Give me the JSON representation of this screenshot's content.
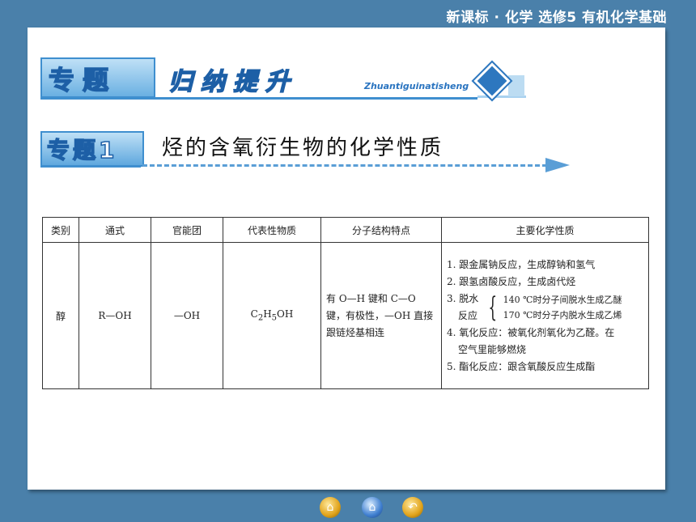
{
  "header": {
    "course": "新课标 · 化学  选修5  有机化学基础"
  },
  "banner": {
    "zhuanti": "专题",
    "guina": "归纳提升",
    "pinyin": "Zhuantiguinatisheng"
  },
  "topic": {
    "badge": "专题1",
    "title": "烃的含氧衍生物的化学性质"
  },
  "table": {
    "headers": [
      "类别",
      "通式",
      "官能团",
      "代表性物质",
      "分子结构特点",
      "主要化学性质"
    ],
    "row": {
      "category": "醇",
      "formula": "R—OH",
      "group": "—OH",
      "rep_main": "C",
      "rep_sub1": "2",
      "rep_mid": "H",
      "rep_sub2": "5",
      "rep_end": "OH",
      "structure": "有 O—H 键和 C—O 键，有极性，—OH 直接跟链烃基相连",
      "props": [
        "1. 跟金属钠反应，生成醇钠和氢气",
        "2. 跟氢卤酸反应，生成卤代烃",
        "3. 脱水",
        "反应",
        "140 ℃时分子间脱水生成乙醚",
        "170 ℃时分子内脱水生成乙烯",
        "4. 氧化反应：被氧化剂氧化为乙醛。在",
        "空气里能够燃烧",
        "5. 酯化反应：跟含氧酸反应生成酯"
      ]
    }
  },
  "nav": {
    "home": "⌂",
    "menu": "⌂",
    "back": "↶"
  }
}
